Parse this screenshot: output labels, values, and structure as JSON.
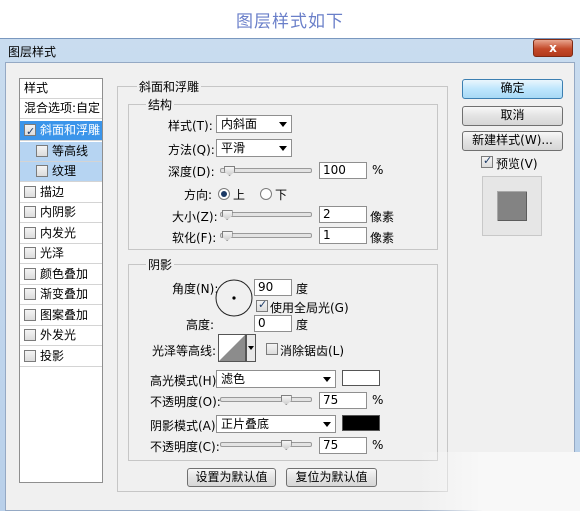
{
  "caption": "图层样式如下",
  "window": {
    "title": "图层样式",
    "close": "x"
  },
  "style_list": {
    "header": "样式",
    "blend": "混合选项:自定",
    "items": [
      {
        "label": "斜面和浮雕",
        "checked": true,
        "selected": true
      },
      {
        "label": "等高线",
        "checked": false,
        "sub": true
      },
      {
        "label": "纹理",
        "checked": false,
        "sub": true
      },
      {
        "label": "描边",
        "checked": false
      },
      {
        "label": "内阴影",
        "checked": false
      },
      {
        "label": "内发光",
        "checked": false
      },
      {
        "label": "光泽",
        "checked": false
      },
      {
        "label": "颜色叠加",
        "checked": false
      },
      {
        "label": "渐变叠加",
        "checked": false
      },
      {
        "label": "图案叠加",
        "checked": false
      },
      {
        "label": "外发光",
        "checked": false
      },
      {
        "label": "投影",
        "checked": false
      }
    ]
  },
  "bevel": {
    "group_title": "斜面和浮雕",
    "structure_title": "结构",
    "style_label": "样式(T):",
    "style_value": "内斜面",
    "method_label": "方法(Q):",
    "method_value": "平滑",
    "depth_label": "深度(D):",
    "depth_value": "100",
    "depth_unit": "%",
    "depth_pct": 0.05,
    "direction_label": "方向:",
    "direction_up": "上",
    "direction_down": "下",
    "size_label": "大小(Z):",
    "size_value": "2",
    "size_unit": "像素",
    "size_pct": 0.02,
    "soften_label": "软化(F):",
    "soften_value": "1",
    "soften_unit": "像素",
    "soften_pct": 0.02
  },
  "shading": {
    "group_title": "阴影",
    "angle_label": "角度(N):",
    "angle_value": "90",
    "angle_unit": "度",
    "global_light_label": "使用全局光(G)",
    "global_light_checked": true,
    "altitude_label": "高度:",
    "altitude_value": "0",
    "altitude_unit": "度",
    "gloss_label": "光泽等高线:",
    "antialias_label": "消除锯齿(L)",
    "antialias_checked": false,
    "highlight_mode_label": "高光模式(H):",
    "highlight_mode_value": "滤色",
    "highlight_color": "#ffffff",
    "highlight_opacity_label": "不透明度(O):",
    "highlight_opacity_value": "75",
    "highlight_opacity_unit": "%",
    "highlight_opacity_pct": 0.75,
    "shadow_mode_label": "阴影模式(A):",
    "shadow_mode_value": "正片叠底",
    "shadow_color": "#000000",
    "shadow_opacity_label": "不透明度(C):",
    "shadow_opacity_value": "75",
    "shadow_opacity_unit": "%",
    "shadow_opacity_pct": 0.75
  },
  "footer": {
    "set_default": "设置为默认值",
    "reset_default": "复位为默认值"
  },
  "actions": {
    "ok": "确定",
    "cancel": "取消",
    "new_style": "新建样式(W)...",
    "preview_label": "预览(V)",
    "preview_checked": true
  }
}
